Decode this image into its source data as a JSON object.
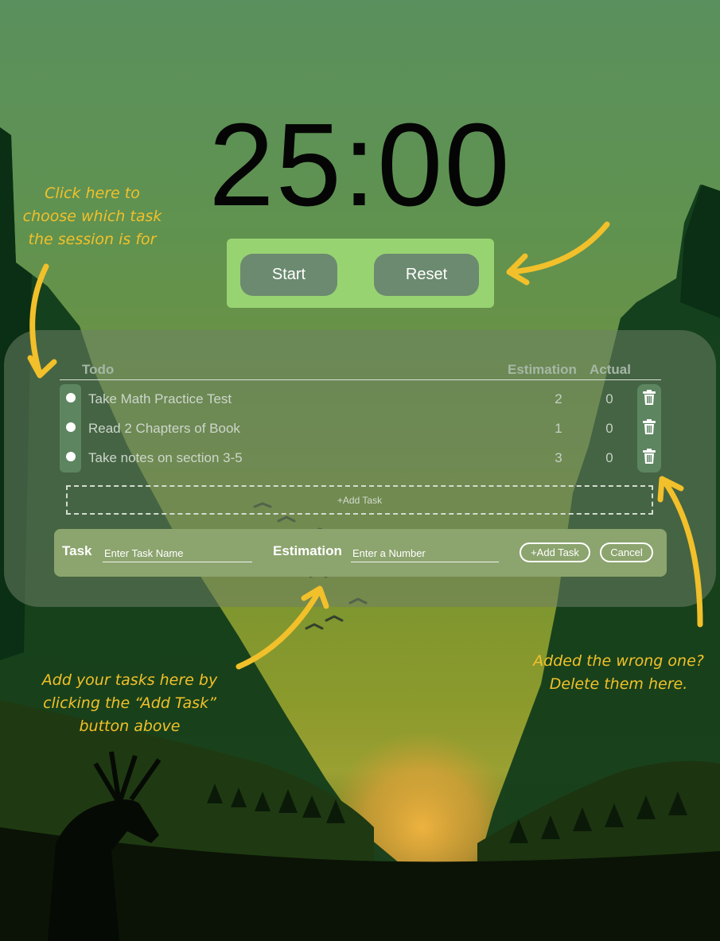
{
  "timer": {
    "display": "25:00"
  },
  "controls": {
    "start_label": "Start",
    "reset_label": "Reset"
  },
  "table": {
    "headers": {
      "todo": "Todo",
      "estimation": "Estimation",
      "actual": "Actual"
    },
    "rows": [
      {
        "name": "Take Math Practice Test",
        "estimation": "2",
        "actual": "0"
      },
      {
        "name": "Read 2 Chapters of Book",
        "estimation": "1",
        "actual": "0"
      },
      {
        "name": "Take notes on section 3-5",
        "estimation": "3",
        "actual": "0"
      }
    ],
    "add_task_label": "+Add Task"
  },
  "form": {
    "task_label": "Task",
    "task_placeholder": "Enter Task Name",
    "estimation_label": "Estimation",
    "estimation_placeholder": "Enter a Number",
    "add_button": "+Add Task",
    "cancel_button": "Cancel"
  },
  "annotations": {
    "choose_task": "Click here to\nchoose which task\nthe session is for",
    "add_tasks": "Add your tasks here by\nclicking the “Add Task”\nbutton above",
    "delete_tasks": "Added the wrong one?\nDelete them here."
  },
  "colors": {
    "accent_annotation": "#f2c02a",
    "controls_bg": "#98d372",
    "button_bg": "#6b8a6f"
  },
  "icons": [
    "trash-icon",
    "radio-icon",
    "arrow-icon"
  ]
}
